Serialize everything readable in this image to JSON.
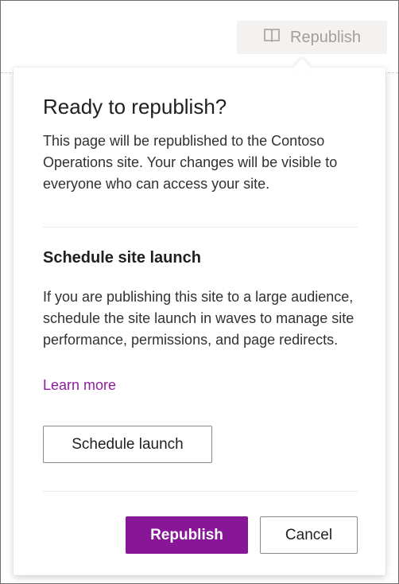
{
  "toolbar": {
    "republish_label": "Republish",
    "republish_icon": "book-icon"
  },
  "callout": {
    "title": "Ready to republish?",
    "description": "This page will be republished to the Contoso Operations site. Your changes will be visible to everyone who can access your site.",
    "schedule": {
      "heading": "Schedule site launch",
      "description": "If you are publishing this site to a large audience, schedule the site launch in waves to manage site performance, permissions, and page redirects.",
      "learn_more": "Learn more",
      "button_label": "Schedule launch"
    },
    "actions": {
      "primary_label": "Republish",
      "cancel_label": "Cancel"
    }
  },
  "colors": {
    "accent": "#881798",
    "link": "#8f1f9e",
    "disabled_text": "#a19f9d",
    "disabled_bg": "#f3f2f1"
  }
}
